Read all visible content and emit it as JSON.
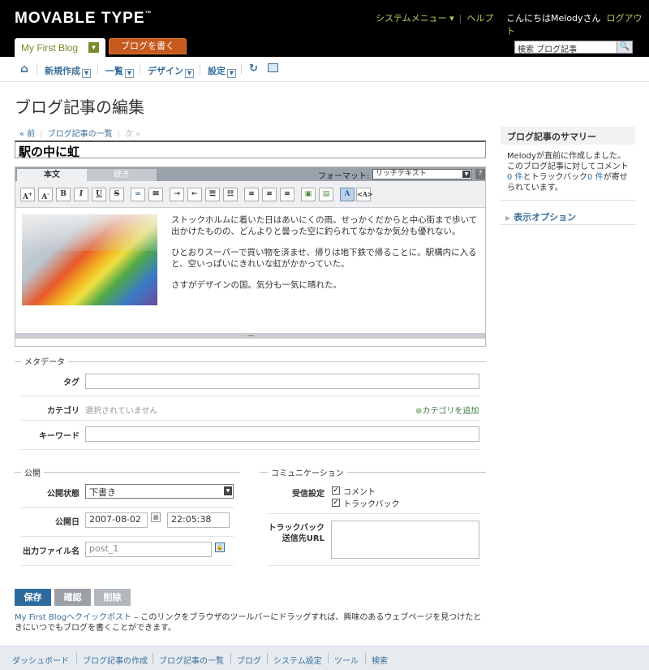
{
  "header": {
    "logo": "MOVABLE TYPE",
    "logo_mark": "™",
    "system_menu": "システムメニュー ▾",
    "help": "ヘルプ",
    "greeting": "こんにちはMelodyさん",
    "logout": "ログアウト",
    "blog_name": "My First Blog",
    "write_button": "ブログを書く",
    "search_value": "検索 ブログ記事"
  },
  "nav": {
    "items": [
      {
        "label": "新規作成"
      },
      {
        "label": "一覧"
      },
      {
        "label": "デザイン"
      },
      {
        "label": "設定"
      }
    ]
  },
  "page": {
    "title": "ブログ記事の編集",
    "prev": "« 前",
    "list": "ブログ記事の一覧",
    "next": "次 »",
    "entry_title": "駅の中に虹"
  },
  "editor": {
    "tab_body": "本文",
    "tab_more": "続き",
    "format_label": "フォーマット:",
    "format_value": "リッチテキスト",
    "help": "?",
    "paragraphs": [
      "ストックホルムに着いた日はあいにくの雨。せっかくだからと中心街まで歩いて出かけたものの、どんよりと曇った空に釣られてなかなか気分も優れない。",
      "ひとおりスーパーで買い物を済ませ、帰りは地下鉄で帰ることに。駅構内に入ると、空いっぱいにきれいな虹がかかっていた。",
      "さすがデザインの国。気分も一気に晴れた。"
    ],
    "toolbar": [
      "A+",
      "A-",
      "B",
      "I",
      "U",
      "S",
      "∞",
      "✉",
      "≡",
      "≡",
      "☰",
      "☰",
      "≡",
      "≡",
      "≡",
      "▣",
      "▣",
      "A",
      "<A>"
    ]
  },
  "metadata": {
    "legend": "メタデータ",
    "tags_label": "タグ",
    "tags_value": "",
    "category_label": "カテゴリ",
    "category_value": "選択されていません",
    "add_category": "カテゴリを追加",
    "keywords_label": "キーワード",
    "keywords_value": ""
  },
  "publish": {
    "legend": "公開",
    "status_label": "公開状態",
    "status_value": "下書き",
    "date_label": "公開日",
    "date_value": "2007-08-02",
    "time_value": "22:05:38",
    "basename_label": "出力ファイル名",
    "basename_value": "post_1"
  },
  "communication": {
    "legend": "コミュニケーション",
    "accept_label": "受信設定",
    "comments_label": "コメント",
    "comments_checked": true,
    "trackbacks_label": "トラックバック",
    "trackbacks_checked": true,
    "ping_label_1": "トラックバック",
    "ping_label_2": "送信先URL",
    "ping_value": ""
  },
  "actions": {
    "save": "保存",
    "preview": "確認",
    "delete": "削除",
    "quickpost_link": "My First Blogへクイックポスト",
    "quickpost_text": " – このリンクをブラウザのツールバーにドラッグすれば、興味のあるウェブページを見つけたときにいつでもブログを書くことができます。"
  },
  "sidebar": {
    "summary_title": "ブログ記事のサマリー",
    "summary_text_1": "Melodyが直前に作成しました。このブログ記事に対してコメント",
    "comment_count": "0 件",
    "summary_text_2": "とトラックバック",
    "trackback_count": "0 件",
    "summary_text_3": "が寄せられています。",
    "display_options": "表示オプション"
  },
  "footer": {
    "links": [
      "ダッシュボード",
      "ブログ記事の作成",
      "ブログ記事の一覧",
      "ブログ",
      "システム設定",
      "ツール",
      "検索"
    ]
  },
  "colors": {
    "header_bg": "#000000",
    "accent_green": "#c7c85a",
    "write_button": "#c65a1e",
    "link": "#3a6f9a",
    "save_button": "#2c6a9e"
  }
}
